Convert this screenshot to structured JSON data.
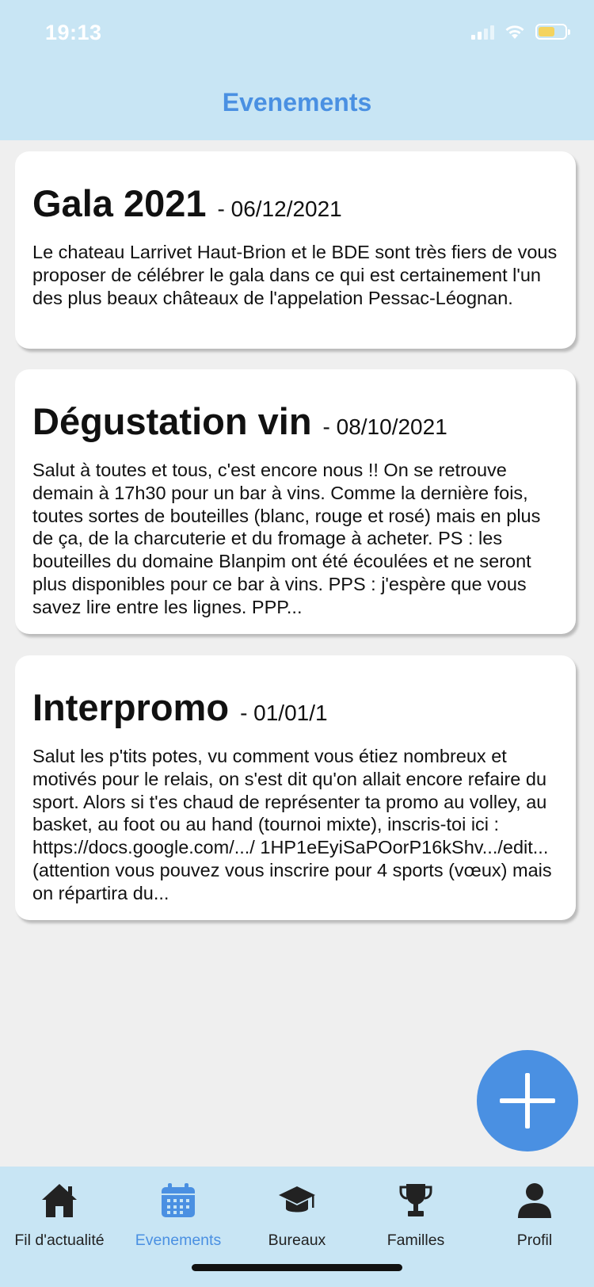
{
  "status_bar": {
    "time": "19:13"
  },
  "header": {
    "title": "Evenements"
  },
  "events": [
    {
      "title": "Gala 2021",
      "date": "- 06/12/2021",
      "description": "Le chateau Larrivet Haut-Brion et le BDE sont très fiers de vous proposer de célébrer le gala dans ce qui est certainement l'un des plus beaux châteaux de l'appelation Pessac-Léognan."
    },
    {
      "title": "Dégustation vin",
      "date": "- 08/10/2021",
      "description": "Salut à toutes et tous, c'est encore nous !! On se retrouve demain à 17h30 pour un bar à vins. Comme la dernière fois, toutes sortes de bouteilles (blanc, rouge et rosé) mais en plus de ça, de la charcuterie et du fromage à acheter.  PS : les bouteilles du domaine Blanpim ont été écoulées et ne seront plus disponibles pour ce bar à vins. PPS : j'espère que vous savez lire entre les lignes. PPP..."
    },
    {
      "title": "Interpromo",
      "date": "- 01/01/1",
      "description": "Salut les p'tits potes, vu comment vous étiez nombreux et motivés pour le relais, on s'est dit qu'on allait encore refaire du sport. Alors si t'es chaud de représenter ta promo au volley, au basket, au foot ou au hand (tournoi mixte), inscris-toi ici : https://docs.google.com/.../ 1HP1eEyiSaPOorP16kShv.../edit... (attention vous pouvez vous inscrire pour 4 sports (vœux) mais on répartira du..."
    }
  ],
  "fab": {
    "icon": "plus-icon"
  },
  "tabbar": {
    "tabs": [
      {
        "label": "Fil d'actualité",
        "icon": "home-icon"
      },
      {
        "label": "Evenements",
        "icon": "calendar-icon"
      },
      {
        "label": "Bureaux",
        "icon": "graduation-cap-icon"
      },
      {
        "label": "Familles",
        "icon": "trophy-icon"
      },
      {
        "label": "Profil",
        "icon": "user-icon"
      }
    ],
    "active_index": 1
  },
  "colors": {
    "accent": "#4a90e2",
    "header_bg": "#c8e5f4",
    "page_bg": "#efefef",
    "battery": "#f4d35e"
  }
}
